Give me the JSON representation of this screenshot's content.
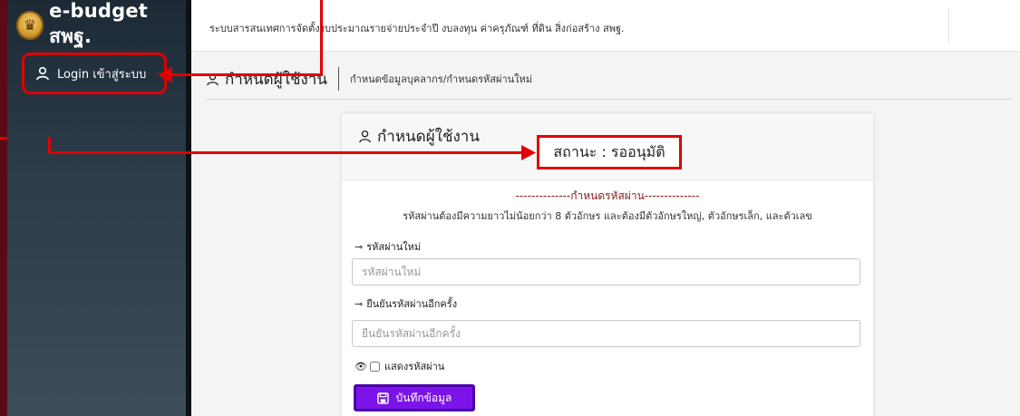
{
  "brand": {
    "logo_icon": "thai-emblem-icon",
    "name": "e-budget สพฐ."
  },
  "sidebar": {
    "login_label": "Login เข้าสู่ระบบ"
  },
  "topbar": {
    "title": "ระบบสารสนเทศการจัดตั้งงบประมาณรายจ่ายประจำปี งบลงทุน ค่าครุภัณฑ์ ที่ดิน สิ่งก่อสร้าง สพฐ."
  },
  "breadcrumb": {
    "main": "กำหนดผู้ใช้งาน",
    "sub": "กำหนดข้อมูลบุคลากร/กำหนดรหัสผ่านใหม่"
  },
  "card": {
    "title": "กำหนดผู้ใช้งาน",
    "status": "สถานะ : รออนุมัติ",
    "password_heading": "--------------กำหนดรหัสผ่าน--------------",
    "password_rule": "รหัสผ่านต้องมีความยาวไม่น้อยกว่า 8 ตัวอักษร และต้องมีตัวอักษรใหญ่, ตัวอักษรเล็ก, และตัวเลข",
    "new_password": {
      "label": "รหัสผ่านใหม่",
      "placeholder": "รหัสผ่านใหม่",
      "value": ""
    },
    "confirm_password": {
      "label": "ยืนยันรหัสผ่านอีกครั้ง",
      "placeholder": "ยืนยันรหัสผ่านอีกครั้ง",
      "value": ""
    },
    "show_password_label": "แสดงรหัสผ่าน",
    "save_label": "บันทึกข้อมูล"
  },
  "colors": {
    "annotation": "#e00000",
    "save_button": "#7b14e8",
    "heading": "#8b1a1a"
  }
}
